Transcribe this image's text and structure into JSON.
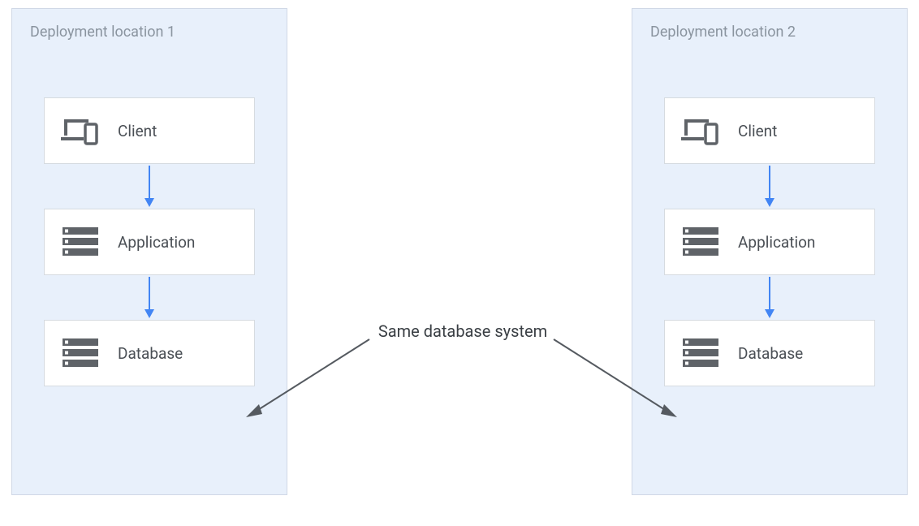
{
  "locations": [
    {
      "title": "Deployment location 1",
      "nodes": {
        "client": "Client",
        "application": "Application",
        "database": "Database"
      }
    },
    {
      "title": "Deployment location 2",
      "nodes": {
        "client": "Client",
        "application": "Application",
        "database": "Database"
      }
    }
  ],
  "center_annotation": "Same database system",
  "colors": {
    "arrow_blue": "#4285f4",
    "arrow_dark": "#555a60",
    "box_bg": "#e8f0fb",
    "icon": "#5f6368"
  }
}
